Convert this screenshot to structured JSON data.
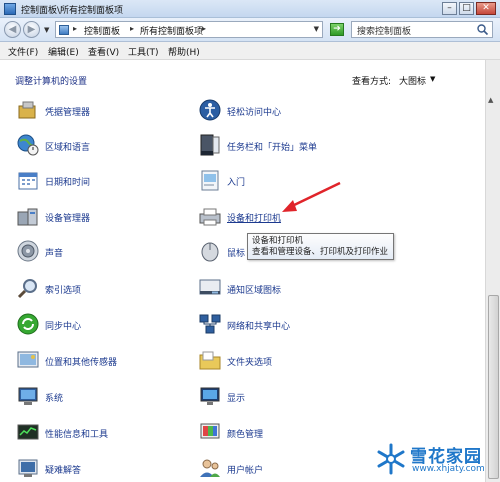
{
  "window": {
    "title": "控制面板\\所有控制面板项"
  },
  "address": {
    "crumbs": [
      "控制面板",
      "所有控制面板项"
    ],
    "search_placeholder": "搜索控制面板"
  },
  "menu": [
    "文件(F)",
    "编辑(E)",
    "查看(V)",
    "工具(T)",
    "帮助(H)"
  ],
  "content": {
    "heading": "调整计算机的设置",
    "view_by_label": "查看方式:",
    "view_by_value": "大图标"
  },
  "items_left": [
    {
      "label": "凭据管理器",
      "icon": "credential-manager-icon"
    },
    {
      "label": "区域和语言",
      "icon": "globe-clock-icon"
    },
    {
      "label": "日期和时间",
      "icon": "calendar-icon"
    },
    {
      "label": "设备管理器",
      "icon": "device-manager-icon"
    },
    {
      "label": "声音",
      "icon": "speaker-icon"
    },
    {
      "label": "索引选项",
      "icon": "magnifier-icon"
    },
    {
      "label": "同步中心",
      "icon": "sync-icon"
    },
    {
      "label": "位置和其他传感器",
      "icon": "sensor-icon"
    },
    {
      "label": "系统",
      "icon": "computer-icon"
    },
    {
      "label": "性能信息和工具",
      "icon": "performance-icon"
    },
    {
      "label": "疑难解答",
      "icon": "troubleshoot-icon"
    }
  ],
  "items_right": [
    {
      "label": "轻松访问中心",
      "icon": "ease-of-access-icon"
    },
    {
      "label": "任务栏和「开始」菜单",
      "icon": "taskbar-icon"
    },
    {
      "label": "入门",
      "icon": "getting-started-icon"
    },
    {
      "label": "设备和打印机",
      "icon": "printer-icon"
    },
    {
      "label": "鼠标",
      "icon": "mouse-icon"
    },
    {
      "label": "通知区域图标",
      "icon": "notification-area-icon"
    },
    {
      "label": "网络和共享中心",
      "icon": "network-icon"
    },
    {
      "label": "文件夹选项",
      "icon": "folder-options-icon"
    },
    {
      "label": "显示",
      "icon": "display-icon"
    },
    {
      "label": "颜色管理",
      "icon": "color-management-icon"
    },
    {
      "label": "用户帐户",
      "icon": "user-accounts-icon"
    }
  ],
  "tooltip": {
    "title": "设备和打印机",
    "description": "查看和管理设备、打印机及打印作业"
  },
  "watermark": {
    "name": "雪花家园",
    "url": "www.xhjaty.com"
  },
  "colors": {
    "link": "#1c3a8f",
    "heading": "#1e3287",
    "arrow": "#e0242a",
    "watermark": "#1f77c9"
  }
}
